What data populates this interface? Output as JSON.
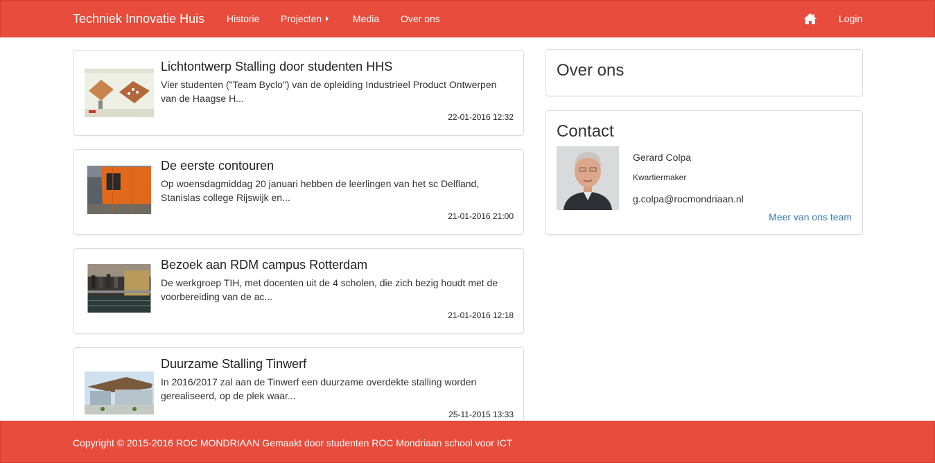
{
  "navbar": {
    "brand": "Techniek Innovatie Huis",
    "items": [
      {
        "label": "Historie"
      },
      {
        "label": "Projecten",
        "has_caret": true
      },
      {
        "label": "Media"
      },
      {
        "label": "Over ons"
      }
    ],
    "home_icon": "home-icon",
    "login": "Login"
  },
  "posts": [
    {
      "title": "Lichtontwerp Stalling door studenten HHS",
      "excerpt": "Vier studenten (\"Team Byclo\") van de opleiding Industrieel Product Ontwerpen van de Haagse H...",
      "date": "22-01-2016 12:32"
    },
    {
      "title": "De eerste contouren",
      "excerpt": "Op woensdagmiddag 20 januari hebben de leerlingen van het sc Delfland, Stanislas college Rijswijk en...",
      "date": "21-01-2016 21:00"
    },
    {
      "title": "Bezoek aan RDM campus Rotterdam",
      "excerpt": "De werkgroep TIH, met docenten uit de 4 scholen, die zich bezig houdt met de voorbereiding van de ac...",
      "date": "21-01-2016 12:18"
    },
    {
      "title": "Duurzame Stalling Tinwerf",
      "excerpt": "In 2016/2017 zal aan de Tinwerf een duurzame overdekte stalling worden gerealiseerd, op de plek waar...",
      "date": "25-11-2015 13:33"
    }
  ],
  "sidebar": {
    "about_title": "Over ons",
    "contact": {
      "title": "Contact",
      "name": "Gerard Colpa",
      "role": "Kwartiermaker",
      "email": "g.colpa@rocmondriaan.nl",
      "team_link": "Meer van ons team"
    }
  },
  "footer": {
    "text": "Copyright © 2015-2016 ROC MONDRIAAN Gemaakt door studenten ROC Mondriaan school voor ICT"
  },
  "colors": {
    "brand_red": "#e74c3c",
    "link_blue": "#337ab7"
  }
}
